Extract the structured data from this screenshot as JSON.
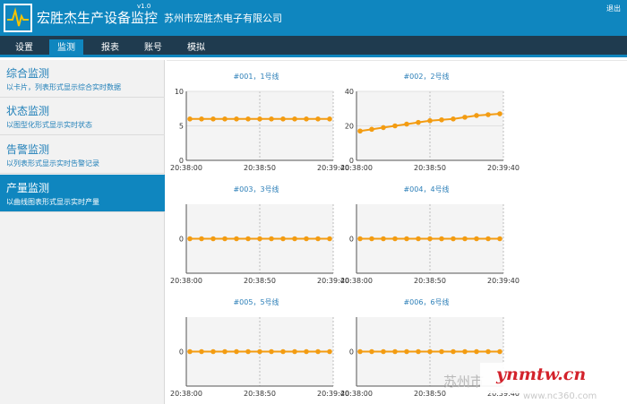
{
  "header": {
    "title": "宏胜杰生产设备监控",
    "version": "v1.0",
    "company": "苏州市宏胜杰电子有限公司",
    "logout": "退出",
    "colors": {
      "header_bg": "#0f86bf",
      "menubar_bg": "#1f3b4f",
      "accent": "#0f86bf"
    }
  },
  "menu": {
    "items": [
      "设置",
      "监测",
      "报表",
      "账号",
      "模拟"
    ],
    "active_index": 1
  },
  "sidebar": {
    "items": [
      {
        "title": "综合监测",
        "desc": "以卡片，列表形式显示综合实时数据"
      },
      {
        "title": "状态监测",
        "desc": "以图型化形式显示实时状态"
      },
      {
        "title": "告警监测",
        "desc": "以列表形式显示实时告警记录"
      },
      {
        "title": "产量监测",
        "desc": "以曲线图表形式显示实时产量"
      }
    ],
    "active_index": 3
  },
  "watermark": {
    "text": "苏州市",
    "brand": "ynmtw.cn",
    "url": "www.nc360.com"
  },
  "chart_data": [
    {
      "type": "line",
      "title": "#001，1号线",
      "x_ticks": [
        "20:38:00",
        "20:38:50",
        "20:39:40"
      ],
      "y_ticks": [
        "0",
        "5",
        "10"
      ],
      "ylim": [
        0,
        10
      ],
      "grid": true,
      "color": "#f39c12",
      "values": [
        6,
        6,
        6,
        6,
        6,
        6,
        6,
        6,
        6,
        6,
        6,
        6,
        6
      ]
    },
    {
      "type": "line",
      "title": "#002，2号线",
      "x_ticks": [
        "20:38:00",
        "20:38:50",
        "20:39:40"
      ],
      "y_ticks": [
        "0",
        "20",
        "40"
      ],
      "ylim": [
        0,
        40
      ],
      "grid": true,
      "color": "#f39c12",
      "values": [
        17,
        18,
        19,
        20,
        21,
        22,
        23,
        23.5,
        24,
        25,
        26,
        26.5,
        27
      ]
    },
    {
      "type": "line",
      "title": "#003，3号线",
      "x_ticks": [
        "20:38:00",
        "20:38:50",
        "20:39:40"
      ],
      "y_ticks": [
        "0"
      ],
      "ylim": [
        -1,
        1
      ],
      "grid": true,
      "color": "#f39c12",
      "values": [
        0,
        0,
        0,
        0,
        0,
        0,
        0,
        0,
        0,
        0,
        0,
        0,
        0
      ]
    },
    {
      "type": "line",
      "title": "#004，4号线",
      "x_ticks": [
        "20:38:00",
        "20:38:50",
        "20:39:40"
      ],
      "y_ticks": [
        "0"
      ],
      "ylim": [
        -1,
        1
      ],
      "grid": true,
      "color": "#f39c12",
      "values": [
        0,
        0,
        0,
        0,
        0,
        0,
        0,
        0,
        0,
        0,
        0,
        0,
        0
      ]
    },
    {
      "type": "line",
      "title": "#005，5号线",
      "x_ticks": [
        "20:38:00",
        "20:38:50",
        "20:39:40"
      ],
      "y_ticks": [
        "0"
      ],
      "ylim": [
        -1,
        1
      ],
      "grid": true,
      "color": "#f39c12",
      "values": [
        0,
        0,
        0,
        0,
        0,
        0,
        0,
        0,
        0,
        0,
        0,
        0,
        0
      ]
    },
    {
      "type": "line",
      "title": "#006，6号线",
      "x_ticks": [
        "20:38:00",
        "20:38:50",
        "20:39:40"
      ],
      "y_ticks": [
        "0"
      ],
      "ylim": [
        -1,
        1
      ],
      "grid": true,
      "color": "#f39c12",
      "values": [
        0,
        0,
        0,
        0,
        0,
        0,
        0,
        0,
        0,
        0,
        0,
        0,
        0
      ]
    }
  ]
}
